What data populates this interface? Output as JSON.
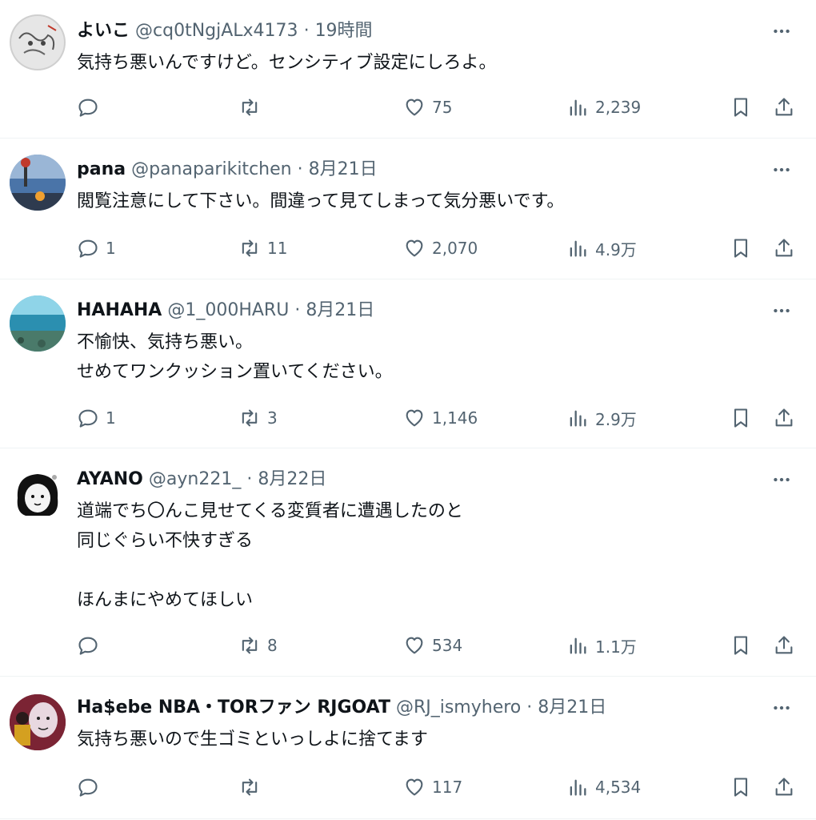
{
  "posts": [
    {
      "name": "よいこ",
      "handle": "@cq0tNgjALx4173",
      "time": "19時間",
      "lines": [
        "気持ち悪いんですけど。センシティブ設定にしろよ。"
      ],
      "replies": "",
      "retweets": "",
      "likes": "75",
      "views": "2,239",
      "avatar": "sketch-avatar"
    },
    {
      "name": "pana",
      "handle": "@panaparikitchen",
      "time": "8月21日",
      "lines": [
        "閲覧注意にして下さい。間違って見てしまって気分悪いです。"
      ],
      "replies": "1",
      "retweets": "11",
      "likes": "2,070",
      "views": "4.9万",
      "avatar": "sunset-avatar"
    },
    {
      "name": "HAHAHA",
      "handle": "@1_000HARU",
      "time": "8月21日",
      "lines": [
        "不愉快、気持ち悪い。",
        "せめてワンクッション置いてください。"
      ],
      "replies": "1",
      "retweets": "3",
      "likes": "1,146",
      "views": "2.9万",
      "avatar": "ocean-avatar"
    },
    {
      "name": "AYANO",
      "handle": "@ayn221_",
      "time": "8月22日",
      "lines": [
        "道端でち〇んこ見せてくる変質者に遭遇したのと",
        "同じぐらい不快すぎる",
        "",
        "ほんまにやめてほしい"
      ],
      "replies": "",
      "retweets": "8",
      "likes": "534",
      "views": "1.1万",
      "avatar": "drawing-avatar"
    },
    {
      "name": "Ha$ebe NBA・TORファン RJGOAT",
      "handle": "@RJ_ismyhero",
      "time": "8月21日",
      "lines": [
        "気持ち悪いので生ゴミといっしよに捨てます"
      ],
      "replies": "",
      "retweets": "",
      "likes": "117",
      "views": "4,534",
      "avatar": "player-avatar"
    }
  ],
  "ui": {
    "dot": "·",
    "icons": {
      "more": "more-icon",
      "reply": "reply-icon",
      "retweet": "retweet-icon",
      "like": "heart-icon",
      "views": "views-icon",
      "bookmark": "bookmark-icon",
      "share": "share-icon"
    }
  },
  "colors": {
    "text": "#0f1419",
    "secondary": "#536471",
    "divider": "#eff3f4"
  }
}
